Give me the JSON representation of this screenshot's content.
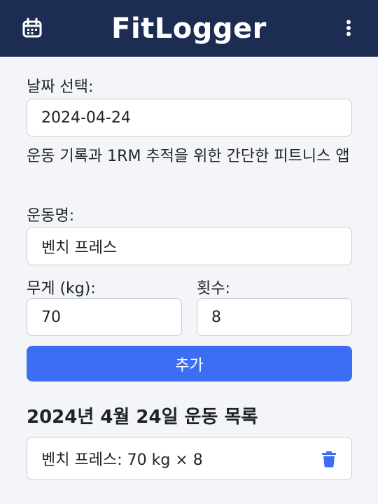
{
  "header": {
    "title": "FitLogger",
    "calendar_icon": "calendar-icon",
    "menu_icon": "kebab-menu-icon",
    "background": "#1c2c52"
  },
  "form": {
    "date_label": "날짜 선택:",
    "date_value": "2024-04-24",
    "description": "운동 기록과 1RM 추적을 위한 간단한 피트니스 앱",
    "exercise_label": "운동명:",
    "exercise_value": "벤치 프레스",
    "weight_label": "무게 (kg):",
    "weight_value": "70",
    "reps_label": "횟수:",
    "reps_value": "8",
    "add_button": "추가",
    "accent": "#3d6df2"
  },
  "log": {
    "title": "2024년 4월 24일 운동 목록",
    "items": [
      {
        "text": "벤치 프레스: 70 kg × 8",
        "delete_icon": "trash-icon"
      }
    ]
  }
}
